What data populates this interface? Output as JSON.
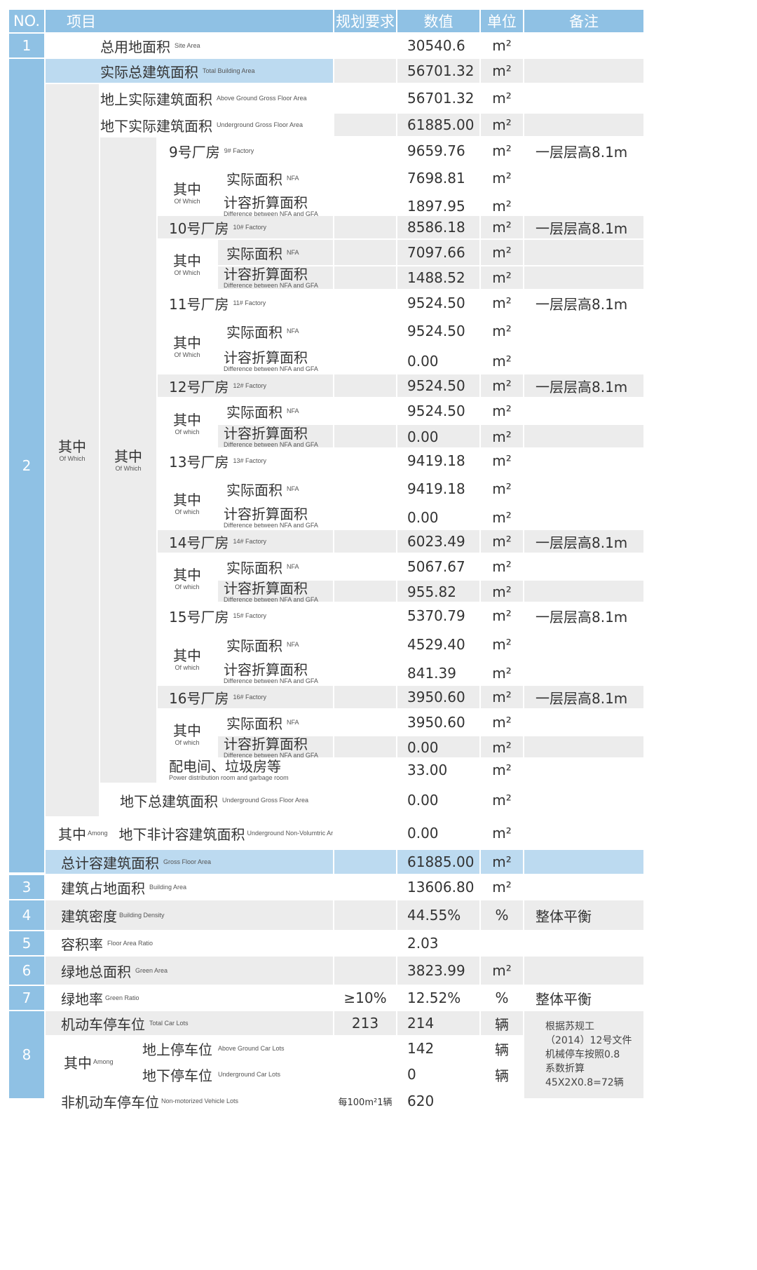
{
  "header": {
    "no": "NO.",
    "item": "项目",
    "req": "规划要求",
    "value": "数值",
    "unit": "单位",
    "remark": "备注"
  },
  "rows": {
    "r1": {
      "no": "1",
      "zh": "总用地面积",
      "en": "Site Area",
      "value": "30540.6",
      "unit": "m²"
    },
    "r2": {
      "no": "2",
      "zh": "实际总建筑面积",
      "en": "Total Building Area",
      "value": "56701.32",
      "unit": "m²"
    },
    "above": {
      "zh": "地上实际建筑面积",
      "en": "Above Ground Gross Floor Area",
      "value": "56701.32",
      "unit": "m²"
    },
    "under": {
      "zh": "地下实际建筑面积",
      "en": "Underground Gross Floor Area",
      "value": "61885.00",
      "unit": "m²"
    },
    "which_outer": {
      "zh": "其中",
      "en": "Of Which"
    },
    "which_inner": {
      "zh": "其中",
      "en": "Of Which"
    }
  },
  "factories": [
    {
      "zh": "9号厂房",
      "en": "9# Factory",
      "value": "9659.76",
      "unit": "m²",
      "remark": "一层层高8.1m",
      "which_zh": "其中",
      "which_en": "Of Which",
      "nfa_zh": "实际面积",
      "nfa_en": "NFA",
      "nfa_value": "7698.81",
      "nfa_unit": "m²",
      "diff_zh": "计容折算面积",
      "diff_en": "Difference between NFA and GFA",
      "diff_value": "1897.95",
      "diff_unit": "m²"
    },
    {
      "zh": "10号厂房",
      "en": "10# Factory",
      "value": "8586.18",
      "unit": "m²",
      "remark": "一层层高8.1m",
      "which_zh": "其中",
      "which_en": "Of Which",
      "nfa_zh": "实际面积",
      "nfa_en": "NFA",
      "nfa_value": "7097.66",
      "nfa_unit": "m²",
      "diff_zh": "计容折算面积",
      "diff_en": "Difference between NFA and GFA",
      "diff_value": "1488.52",
      "diff_unit": "m²"
    },
    {
      "zh": "11号厂房",
      "en": "11# Factory",
      "value": "9524.50",
      "unit": "m²",
      "remark": "一层层高8.1m",
      "which_zh": "其中",
      "which_en": "Of Which",
      "nfa_zh": "实际面积",
      "nfa_en": "NFA",
      "nfa_value": "9524.50",
      "nfa_unit": "m²",
      "diff_zh": "计容折算面积",
      "diff_en": "Difference between NFA and GFA",
      "diff_value": "0.00",
      "diff_unit": "m²"
    },
    {
      "zh": "12号厂房",
      "en": "12# Factory",
      "value": "9524.50",
      "unit": "m²",
      "remark": "一层层高8.1m",
      "which_zh": "其中",
      "which_en": "Of which",
      "nfa_zh": "实际面积",
      "nfa_en": "NFA",
      "nfa_value": "9524.50",
      "nfa_unit": "m²",
      "diff_zh": "计容折算面积",
      "diff_en": "Difference between NFA and GFA",
      "diff_value": "0.00",
      "diff_unit": "m²"
    },
    {
      "zh": "13号厂房",
      "en": "13# Factory",
      "value": "9419.18",
      "unit": "m²",
      "remark": "",
      "which_zh": "其中",
      "which_en": "Of which",
      "nfa_zh": "实际面积",
      "nfa_en": "NFA",
      "nfa_value": "9419.18",
      "nfa_unit": "m²",
      "diff_zh": "计容折算面积",
      "diff_en": "Difference between NFA and GFA",
      "diff_value": "0.00",
      "diff_unit": "m²"
    },
    {
      "zh": "14号厂房",
      "en": "14# Factory",
      "value": "6023.49",
      "unit": "m²",
      "remark": "一层层高8.1m",
      "which_zh": "其中",
      "which_en": "Of which",
      "nfa_zh": "实际面积",
      "nfa_en": "NFA",
      "nfa_value": "5067.67",
      "nfa_unit": "m²",
      "diff_zh": "计容折算面积",
      "diff_en": "Difference between NFA and GFA",
      "diff_value": "955.82",
      "diff_unit": "m²"
    },
    {
      "zh": "15号厂房",
      "en": "15# Factory",
      "value": "5370.79",
      "unit": "m²",
      "remark": "一层层高8.1m",
      "which_zh": "其中",
      "which_en": "Of which",
      "nfa_zh": "实际面积",
      "nfa_en": "NFA",
      "nfa_value": "4529.40",
      "nfa_unit": "m²",
      "diff_zh": "计容折算面积",
      "diff_en": "Difference between NFA and GFA",
      "diff_value": "841.39",
      "diff_unit": "m²"
    },
    {
      "zh": "16号厂房",
      "en": "16# Factory",
      "value": "3950.60",
      "unit": "m²",
      "remark": "一层层高8.1m",
      "which_zh": "其中",
      "which_en": "Of which",
      "nfa_zh": "实际面积",
      "nfa_en": "NFA",
      "nfa_value": "3950.60",
      "nfa_unit": "m²",
      "diff_zh": "计容折算面积",
      "diff_en": "Difference between NFA and GFA",
      "diff_value": "0.00",
      "diff_unit": "m²"
    }
  ],
  "rest": {
    "power": {
      "zh": "配电间、垃圾房等",
      "en": "Power distribution room and garbage room",
      "value": "33.00",
      "unit": "m²"
    },
    "ug_total": {
      "zh": "地下总建筑面积",
      "en": "Underground Gross Floor Area",
      "value": "0.00",
      "unit": "m²"
    },
    "among": {
      "zh": "其中",
      "en": "Among"
    },
    "ug_nonvol": {
      "zh": "地下非计容建筑面积",
      "en": "Underground Non-Volumtric Area",
      "value": "0.00",
      "unit": "m²"
    },
    "gfa": {
      "zh": "总计容建筑面积",
      "en": "Gross Floor Area",
      "value": "61885.00",
      "unit": "m²"
    },
    "r3": {
      "no": "3",
      "zh": "建筑占地面积",
      "en": "Building Area",
      "value": "13606.80",
      "unit": "m²"
    },
    "r4": {
      "no": "4",
      "zh": "建筑密度",
      "en": "Building Density",
      "value": "44.55%",
      "unit": "%",
      "remark": "整体平衡"
    },
    "r5": {
      "no": "5",
      "zh": "容积率",
      "en": "Floor Area Ratio",
      "value": "2.03",
      "unit": ""
    },
    "r6": {
      "no": "6",
      "zh": "绿地总面积",
      "en": "Green Area",
      "value": "3823.99",
      "unit": "m²"
    },
    "r7": {
      "no": "7",
      "zh": "绿地率",
      "en": "Green Ratio",
      "req": "≥10%",
      "value": "12.52%",
      "unit": "%",
      "remark": "整体平衡"
    },
    "r8": {
      "no": "8",
      "zh": "机动车停车位",
      "en": "Total Car Lots",
      "req": "213",
      "value": "214",
      "unit": "辆",
      "note": [
        "根据苏规工",
        "（2014）12号文件",
        "机械停车按照0.8",
        "系数折算",
        "45X2X0.8=72辆"
      ]
    },
    "among8": {
      "zh": "其中",
      "en": "Among"
    },
    "car_above": {
      "zh": "地上停车位",
      "en": "Above Ground Car Lots",
      "value": "142",
      "unit": "辆"
    },
    "car_under": {
      "zh": "地下停车位",
      "en": "Underground Car Lots",
      "value": "0",
      "unit": "辆"
    },
    "bike": {
      "zh": "非机动车停车位",
      "en": "Non-motorized Vehicle Lots",
      "req": "每100m²1辆",
      "value": "620"
    }
  }
}
